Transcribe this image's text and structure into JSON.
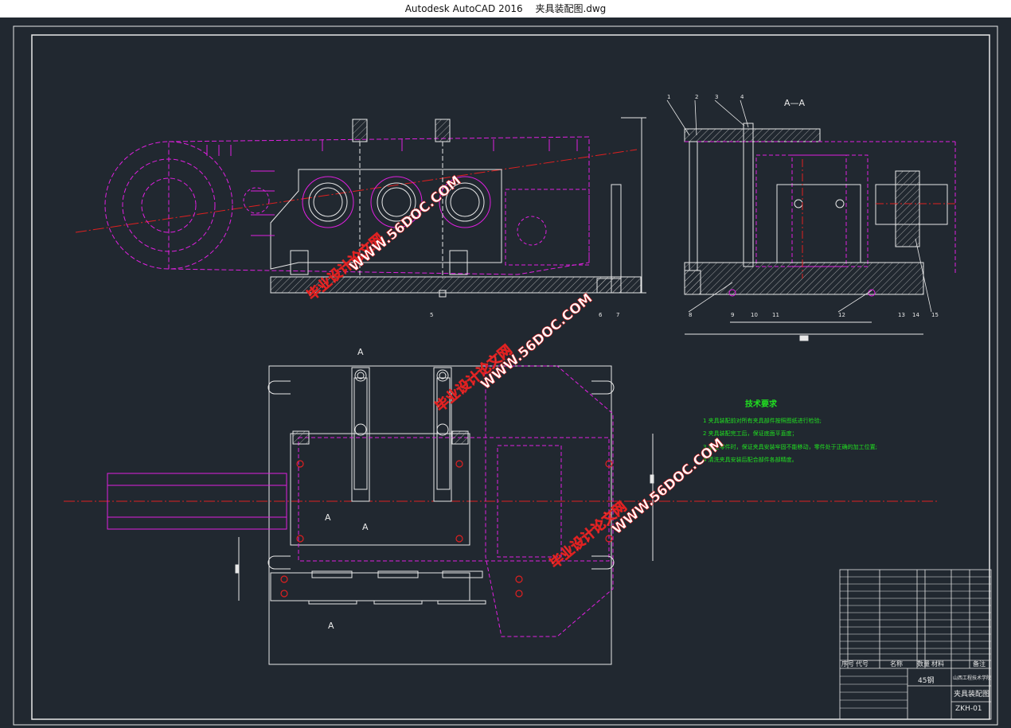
{
  "window": {
    "app_title": "Autodesk AutoCAD 2016",
    "file_name": "夹具装配图.dwg"
  },
  "drawing": {
    "section_label": "A—A",
    "section_mark_a": "A",
    "tech_requirements": {
      "title": "技术要求",
      "items": [
        "1  夹具装配前对所有夹具部件按照图纸进行检验;",
        "2  夹具装配完工后，保证底面平直度；",
        "3  加工零件时，保证夹具安装牢固不能移动，零件处于正确的加工位置;",
        "4  清洗夹具安装后配合部件各部精度。"
      ]
    },
    "watermarks": [
      "毕业设计论文网",
      "WWW.56DOC.COM"
    ],
    "balloons": [
      "1",
      "2",
      "3",
      "4",
      "5",
      "6",
      "7",
      "8",
      "9",
      "10",
      "11",
      "12",
      "13",
      "14",
      "15"
    ],
    "title_block": {
      "material": "45钢",
      "school": "山西工程技术学院",
      "drawing_name": "夹具装配图",
      "drawing_no": "ZKH-01",
      "headers": [
        "序号",
        "代号",
        "名称",
        "数量",
        "材料",
        "备注"
      ]
    }
  },
  "colors": {
    "background": "#212830",
    "line_white": "#e8e8e8",
    "line_magenta": "#e020e0",
    "line_red": "#e02020",
    "text_green": "#20e020"
  }
}
